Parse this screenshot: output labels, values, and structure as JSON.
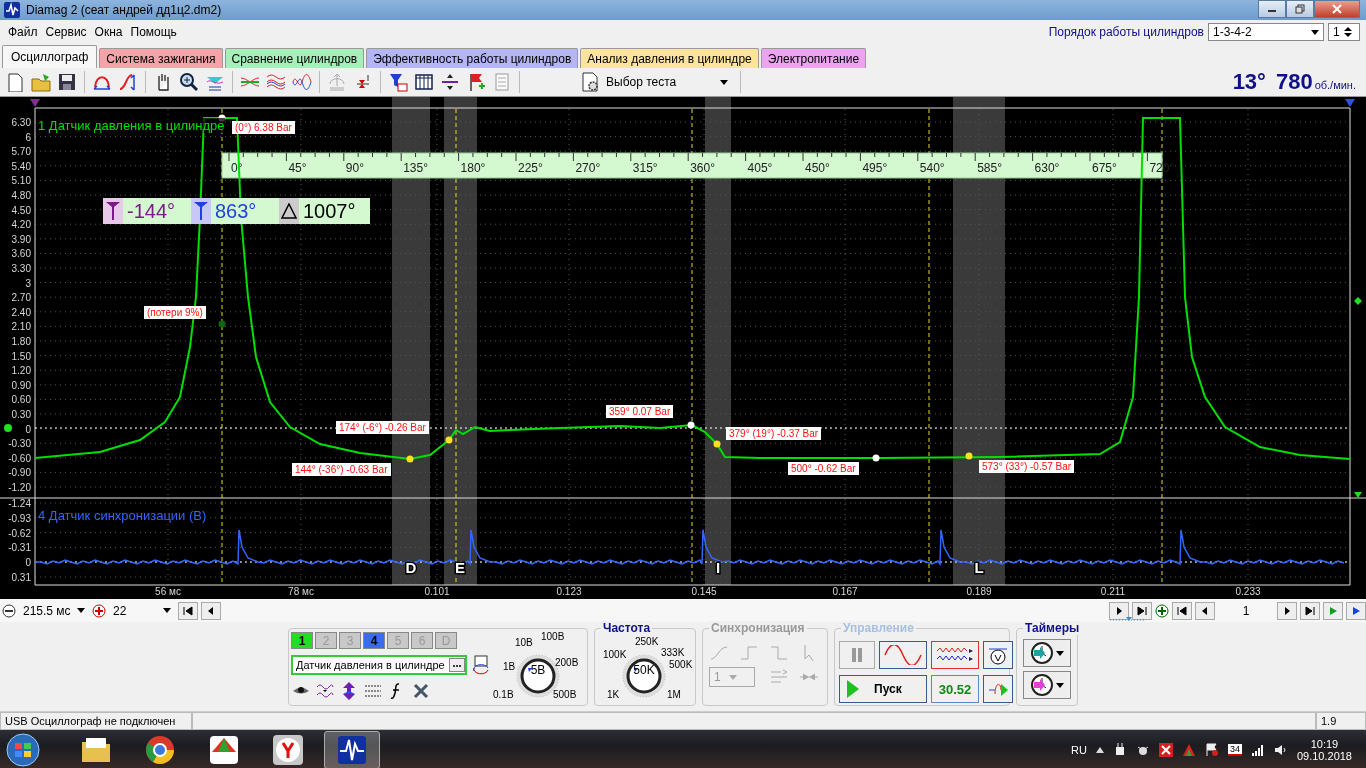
{
  "window": {
    "title": "Diamag 2 (сеат андрей дд1ц2.dm2)"
  },
  "menu": [
    "Файл",
    "Сервис",
    "Окна",
    "Помощь"
  ],
  "firing_order": {
    "label": "Порядок работы цилиндров",
    "value": "1-3-4-2",
    "cylinder": "1"
  },
  "tabs": [
    {
      "label": "Осциллограф",
      "selected": true,
      "color": "#f7f7f7"
    },
    {
      "label": "Система зажигания",
      "selected": false,
      "color": "#f4a3a8"
    },
    {
      "label": "Сравнение цилиндров",
      "selected": false,
      "color": "#a4f0b8"
    },
    {
      "label": "Эффективность работы цилиндров",
      "selected": false,
      "color": "#b4b6f4"
    },
    {
      "label": "Анализ давления в цилиндре",
      "selected": false,
      "color": "#fde49c"
    },
    {
      "label": "Электропитание",
      "selected": false,
      "color": "#eca4f0"
    }
  ],
  "test_select": "Выбор теста",
  "readout": {
    "angle": "13°",
    "rpm": "780",
    "unit": "об./мин."
  },
  "scope": {
    "channels": [
      {
        "label": "1 Датчик давления в цилиндре",
        "color": "#00e000"
      },
      {
        "label": "4 Датчик синхронизации (В)",
        "color": "#3366ff"
      }
    ],
    "y_ticks_1": [
      "6.30",
      "6",
      "5.70",
      "5.40",
      "5.10",
      "4.80",
      "4.50",
      "4.20",
      "3.90",
      "3.60",
      "3.30",
      "3",
      "2.70",
      "2.40",
      "2.10",
      "1.80",
      "1.50",
      "1.20",
      "0.90",
      "0.60",
      "0.30",
      "0",
      "-0.30",
      "-0.60",
      "-0.90",
      "-1.20"
    ],
    "y_ticks_2": [
      "-1.24",
      "-0.93",
      "-0.62",
      "-0.31",
      "0",
      "0.31"
    ],
    "x_ticks": [
      "56 мс",
      "78 мс",
      "0.101",
      "0.123",
      "0.145",
      "0.167",
      "0.189",
      "0.211",
      "0.233"
    ],
    "degree_scale": [
      "0°",
      "45°",
      "90°",
      "135°",
      "180°",
      "225°",
      "270°",
      "315°",
      "360°",
      "405°",
      "450°",
      "495°",
      "540°",
      "585°",
      "630°",
      "675°",
      "720°"
    ],
    "cursors": {
      "start": "-144°",
      "end": "863°",
      "delta": "1007°"
    },
    "zones": [
      "D",
      "E",
      "I",
      "L"
    ],
    "annotations": [
      "(0°) 6.38 Bar",
      "(потери 9%)",
      "174° (-6°) -0.26 Bar",
      "144° (-36°) -0.63 Bar",
      "359° 0.07 Bar",
      "379° (19°) -0.37 Bar",
      "500° -0.62 Bar",
      "573° (33°) -0.57 Bar"
    ]
  },
  "timebase": {
    "value": "215.5 мс",
    "zoom": "22",
    "page": "1"
  },
  "channel_buttons": [
    {
      "label": "1",
      "on": true,
      "color": "#22dd22"
    },
    {
      "label": "2",
      "on": false,
      "color": "#c8c8c8"
    },
    {
      "label": "3",
      "on": false,
      "color": "#c8c8c8"
    },
    {
      "label": "4",
      "on": true,
      "color": "#3a6cf0"
    },
    {
      "label": "5",
      "on": false,
      "color": "#c8c8c8"
    },
    {
      "label": "6",
      "on": false,
      "color": "#c8c8c8"
    },
    {
      "label": "D",
      "on": false,
      "color": "#c8c8c8"
    }
  ],
  "channel_sensor": "Датчик давления в цилиндре",
  "volt_knob": {
    "value": "5В",
    "labels": [
      "10В",
      "100В",
      "1В",
      "200В",
      "0.1В",
      "500В"
    ]
  },
  "frequency": {
    "title": "Частота",
    "value": "50K",
    "labels": [
      "250K",
      "100K",
      "333K",
      "500K",
      "1K",
      "1M"
    ]
  },
  "sync": {
    "title": "Синхронизация",
    "channel": "1",
    "disabled": true
  },
  "control": {
    "title": "Управление",
    "start": "Пуск",
    "rate": "30.52"
  },
  "timers": {
    "title": "Таймеры"
  },
  "status_bar": {
    "message": "USB Осциллограф не подключен",
    "version": "1.9"
  },
  "taskbar": {
    "apps": [
      {
        "selected": false
      },
      {
        "selected": false
      },
      {
        "selected": false
      },
      {
        "selected": false
      },
      {
        "selected": true
      }
    ],
    "language": "RU",
    "tray_badge": "34",
    "time": "10:19",
    "date": "09.10.2018"
  }
}
